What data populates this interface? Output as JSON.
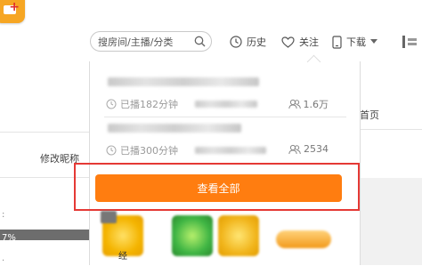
{
  "search": {
    "placeholder": "搜房间/主播/分类"
  },
  "nav": {
    "history": "历史",
    "follow": "关注",
    "download": "下载"
  },
  "left": {
    "edit_nickname": "修改昵称",
    "percent": "7%"
  },
  "right": {
    "homepage": "首页"
  },
  "dropdown": {
    "items": [
      {
        "duration": "已播182分钟",
        "viewers": "1.6万"
      },
      {
        "duration": "已播300分钟",
        "viewers": "2534"
      }
    ],
    "view_all": "查看全部"
  },
  "thumbs": {
    "label": "经"
  },
  "colors": {
    "accent": "#ff7d10",
    "highlight_border": "#e53935"
  }
}
